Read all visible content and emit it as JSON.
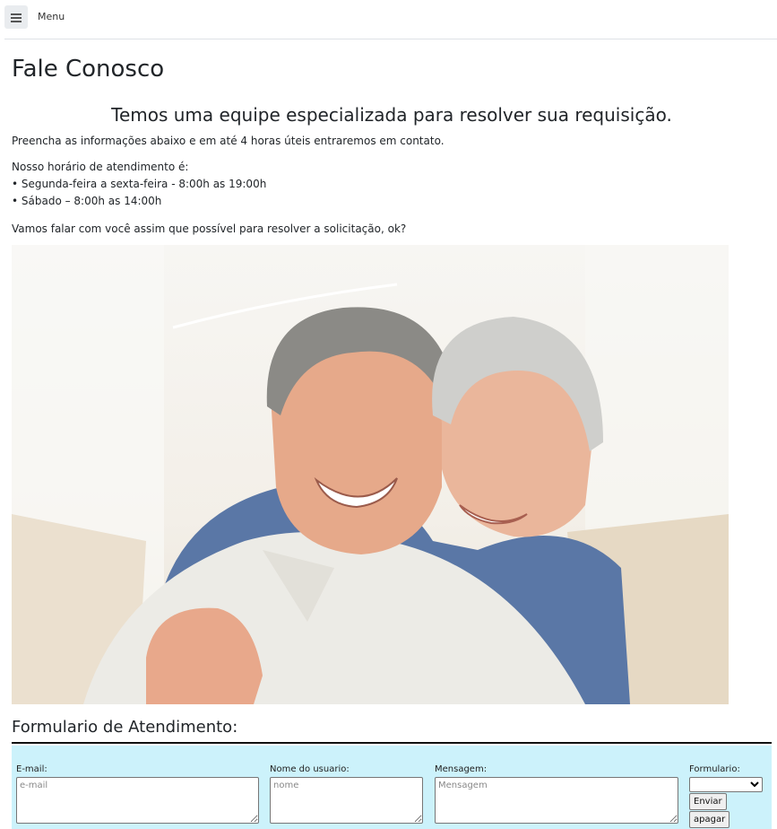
{
  "header": {
    "menu_label": "Menu"
  },
  "page": {
    "title": "Fale Conosco",
    "subtitle": "Temos uma equipe especializada para resolver sua requisição.",
    "intro": "Preencha as informações abaixo e em até 4 horas úteis entraremos em contato.",
    "hours_title": "Nosso horário de atendimento é:",
    "hours": [
      "• Segunda-feira a sexta-feira - 8:00h as 19:00h",
      "• Sábado – 8:00h as 14:00h"
    ],
    "closing": "Vamos falar com você assim que possível para resolver a solicitação, ok?"
  },
  "form": {
    "title": "Formulario de Atendimento:",
    "email_label": "E-mail:",
    "email_placeholder": "e-mail",
    "name_label": "Nome do usuario:",
    "name_placeholder": "nome",
    "message_label": "Mensagem:",
    "message_placeholder": "Mensagem",
    "type_label": "Formulario:",
    "type_selected": "",
    "submit_label": "Enviar",
    "reset_label": "apagar"
  },
  "colors": {
    "form_background": "#ccf2fb",
    "rule": "#111111"
  }
}
